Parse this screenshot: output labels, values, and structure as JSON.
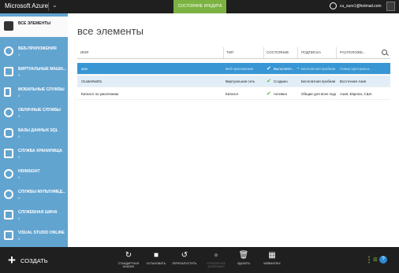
{
  "topbar": {
    "brand": "Microsoft Azure",
    "credit_status": "СОСТОЯНИЕ КРЕДИТА",
    "account_email": "cu_sure1@hotmail.com"
  },
  "sidebar": {
    "items": [
      {
        "label": "ВСЕ ЭЛЕМЕНТЫ",
        "count": ""
      },
      {
        "label": "ВЕБ-ПРИЛОЖЕНИЯ",
        "count": "1"
      },
      {
        "label": "ВИРТУАЛЬНЫЕ МАШИ...",
        "count": "0"
      },
      {
        "label": "МОБИЛЬНЫЕ СЛУЖБЫ",
        "count": "0"
      },
      {
        "label": "ОБЛАЧНЫЕ СЛУЖБЫ",
        "count": "0"
      },
      {
        "label": "БАЗЫ ДАННЫХ SQL",
        "count": "0"
      },
      {
        "label": "СЛУЖБА ХРАНИЛИЩА",
        "count": "0"
      },
      {
        "label": "HDINSIGHT",
        "count": "0"
      },
      {
        "label": "СЛУЖБЫ МУЛЬТИМЕД...",
        "count": "0"
      },
      {
        "label": "СЛУЖЕБНАЯ ШИНА",
        "count": "0"
      },
      {
        "label": "VISUAL STUDIO ONLINE",
        "count": "0"
      }
    ]
  },
  "main": {
    "title": "все элементы",
    "columns": [
      "ИМЯ",
      "ТИП",
      "СОСТОЯНИЕ",
      "ПОДПИСКА",
      "РАСПОЛОЖЕ..."
    ],
    "rows": [
      {
        "name": "azw",
        "type": "Веб-приложение",
        "status": "Выполняет...",
        "subscription": "Бесплатная пробная в...",
        "location": "Север Центральн..."
      },
      {
        "name": "ClusterNet01",
        "type": "Виртуальная сеть",
        "status": "Создано",
        "subscription": "Бесплатная пробная в...",
        "location": "Восточная Азия"
      },
      {
        "name": "Каталог по умолчанию",
        "type": "Каталог",
        "status": "Активно",
        "subscription": "Общие для всех подпи...",
        "location": "Азия, Европа, США"
      }
    ]
  },
  "bottombar": {
    "new_label": "СОЗДАТЬ",
    "tools": [
      {
        "label": "СТАНДАРТНАЯ АНАЛИЗ",
        "icon": "redo-icon"
      },
      {
        "label": "ОСТАНОВИТЬ",
        "icon": "stop-icon"
      },
      {
        "label": "ПЕРЕЗАПУСТИТЬ",
        "icon": "restart-icon"
      },
      {
        "label": "УПРАВЛЕНИЕ ДОМЕНАМИ",
        "icon": "domain-icon"
      },
      {
        "label": "УДАЛИТЬ",
        "icon": "trash-icon"
      },
      {
        "label": "WEBMATRIX",
        "icon": "webmatrix-icon"
      }
    ]
  },
  "colors": {
    "sidebar": "#62a4d0",
    "selected_row": "#3796d3",
    "credit": "#7bb241",
    "bars": "#1f1f1f"
  }
}
